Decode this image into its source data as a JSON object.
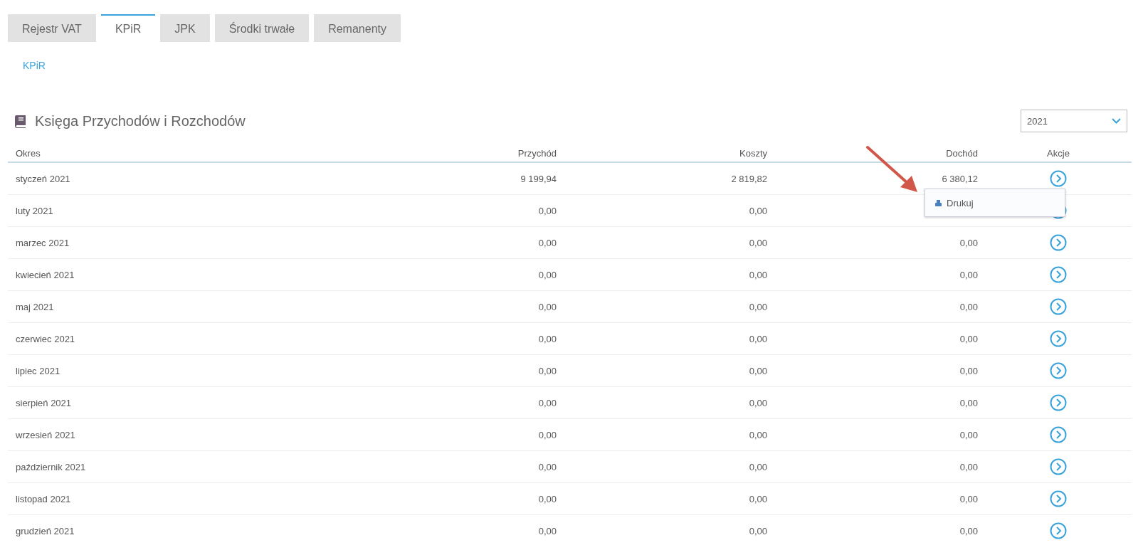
{
  "tabs": [
    {
      "label": "Rejestr VAT",
      "selected": false
    },
    {
      "label": "KPiR",
      "selected": true
    },
    {
      "label": "JPK",
      "selected": false
    },
    {
      "label": "Środki trwałe",
      "selected": false
    },
    {
      "label": "Remanenty",
      "selected": false
    }
  ],
  "breadcrumb": "KPiR",
  "title": "Księga Przychodów i Rozchodów",
  "year_select": {
    "value": "2021"
  },
  "table": {
    "columns": [
      "Okres",
      "Przychód",
      "Koszty",
      "Dochód",
      "Akcje"
    ],
    "rows": [
      {
        "period": "styczeń 2021",
        "income": "9 199,94",
        "costs": "2 819,82",
        "profit": "6 380,12"
      },
      {
        "period": "luty 2021",
        "income": "0,00",
        "costs": "0,00"
      },
      {
        "period": "marzec 2021",
        "income": "0,00",
        "costs": "0,00",
        "profit": "0,00"
      },
      {
        "period": "kwiecień 2021",
        "income": "0,00",
        "costs": "0,00",
        "profit": "0,00"
      },
      {
        "period": "maj 2021",
        "income": "0,00",
        "costs": "0,00",
        "profit": "0,00"
      },
      {
        "period": "czerwiec 2021",
        "income": "0,00",
        "costs": "0,00",
        "profit": "0,00"
      },
      {
        "period": "lipiec 2021",
        "income": "0,00",
        "costs": "0,00",
        "profit": "0,00"
      },
      {
        "period": "sierpień 2021",
        "income": "0,00",
        "costs": "0,00",
        "profit": "0,00"
      },
      {
        "period": "wrzesień 2021",
        "income": "0,00",
        "costs": "0,00",
        "profit": "0,00"
      },
      {
        "period": "październik 2021",
        "income": "0,00",
        "costs": "0,00",
        "profit": "0,00"
      },
      {
        "period": "listopad 2021",
        "income": "0,00",
        "costs": "0,00",
        "profit": "0,00"
      },
      {
        "period": "grudzień 2021",
        "income": "0,00",
        "costs": "0,00",
        "profit": "0,00"
      }
    ]
  },
  "action_menu": {
    "items": [
      "Drukuj"
    ]
  }
}
